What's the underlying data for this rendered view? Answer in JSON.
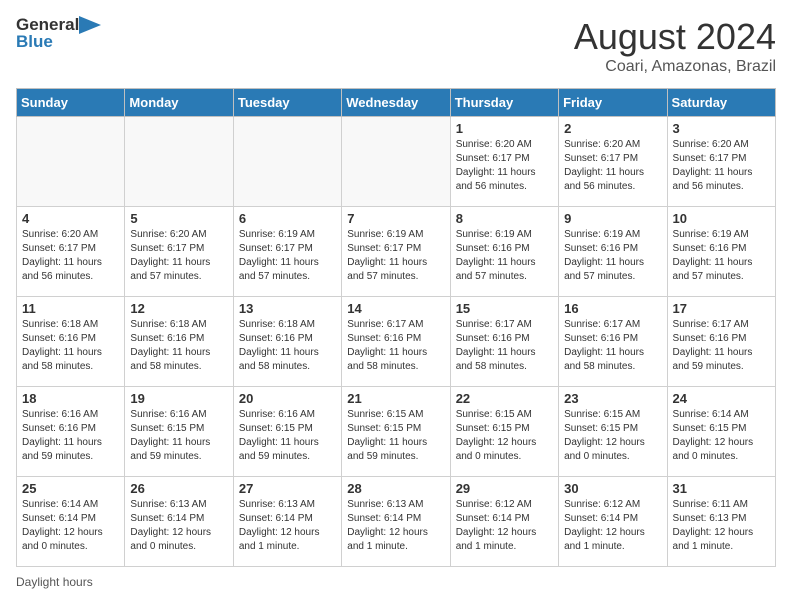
{
  "header": {
    "logo_general": "General",
    "logo_blue": "Blue",
    "title": "August 2024",
    "subtitle": "Coari, Amazonas, Brazil"
  },
  "calendar": {
    "days_of_week": [
      "Sunday",
      "Monday",
      "Tuesday",
      "Wednesday",
      "Thursday",
      "Friday",
      "Saturday"
    ],
    "weeks": [
      [
        {
          "day": "",
          "info": ""
        },
        {
          "day": "",
          "info": ""
        },
        {
          "day": "",
          "info": ""
        },
        {
          "day": "",
          "info": ""
        },
        {
          "day": "1",
          "info": "Sunrise: 6:20 AM\nSunset: 6:17 PM\nDaylight: 11 hours and 56 minutes."
        },
        {
          "day": "2",
          "info": "Sunrise: 6:20 AM\nSunset: 6:17 PM\nDaylight: 11 hours and 56 minutes."
        },
        {
          "day": "3",
          "info": "Sunrise: 6:20 AM\nSunset: 6:17 PM\nDaylight: 11 hours and 56 minutes."
        }
      ],
      [
        {
          "day": "4",
          "info": "Sunrise: 6:20 AM\nSunset: 6:17 PM\nDaylight: 11 hours and 56 minutes."
        },
        {
          "day": "5",
          "info": "Sunrise: 6:20 AM\nSunset: 6:17 PM\nDaylight: 11 hours and 57 minutes."
        },
        {
          "day": "6",
          "info": "Sunrise: 6:19 AM\nSunset: 6:17 PM\nDaylight: 11 hours and 57 minutes."
        },
        {
          "day": "7",
          "info": "Sunrise: 6:19 AM\nSunset: 6:17 PM\nDaylight: 11 hours and 57 minutes."
        },
        {
          "day": "8",
          "info": "Sunrise: 6:19 AM\nSunset: 6:16 PM\nDaylight: 11 hours and 57 minutes."
        },
        {
          "day": "9",
          "info": "Sunrise: 6:19 AM\nSunset: 6:16 PM\nDaylight: 11 hours and 57 minutes."
        },
        {
          "day": "10",
          "info": "Sunrise: 6:19 AM\nSunset: 6:16 PM\nDaylight: 11 hours and 57 minutes."
        }
      ],
      [
        {
          "day": "11",
          "info": "Sunrise: 6:18 AM\nSunset: 6:16 PM\nDaylight: 11 hours and 58 minutes."
        },
        {
          "day": "12",
          "info": "Sunrise: 6:18 AM\nSunset: 6:16 PM\nDaylight: 11 hours and 58 minutes."
        },
        {
          "day": "13",
          "info": "Sunrise: 6:18 AM\nSunset: 6:16 PM\nDaylight: 11 hours and 58 minutes."
        },
        {
          "day": "14",
          "info": "Sunrise: 6:17 AM\nSunset: 6:16 PM\nDaylight: 11 hours and 58 minutes."
        },
        {
          "day": "15",
          "info": "Sunrise: 6:17 AM\nSunset: 6:16 PM\nDaylight: 11 hours and 58 minutes."
        },
        {
          "day": "16",
          "info": "Sunrise: 6:17 AM\nSunset: 6:16 PM\nDaylight: 11 hours and 58 minutes."
        },
        {
          "day": "17",
          "info": "Sunrise: 6:17 AM\nSunset: 6:16 PM\nDaylight: 11 hours and 59 minutes."
        }
      ],
      [
        {
          "day": "18",
          "info": "Sunrise: 6:16 AM\nSunset: 6:16 PM\nDaylight: 11 hours and 59 minutes."
        },
        {
          "day": "19",
          "info": "Sunrise: 6:16 AM\nSunset: 6:15 PM\nDaylight: 11 hours and 59 minutes."
        },
        {
          "day": "20",
          "info": "Sunrise: 6:16 AM\nSunset: 6:15 PM\nDaylight: 11 hours and 59 minutes."
        },
        {
          "day": "21",
          "info": "Sunrise: 6:15 AM\nSunset: 6:15 PM\nDaylight: 11 hours and 59 minutes."
        },
        {
          "day": "22",
          "info": "Sunrise: 6:15 AM\nSunset: 6:15 PM\nDaylight: 12 hours and 0 minutes."
        },
        {
          "day": "23",
          "info": "Sunrise: 6:15 AM\nSunset: 6:15 PM\nDaylight: 12 hours and 0 minutes."
        },
        {
          "day": "24",
          "info": "Sunrise: 6:14 AM\nSunset: 6:15 PM\nDaylight: 12 hours and 0 minutes."
        }
      ],
      [
        {
          "day": "25",
          "info": "Sunrise: 6:14 AM\nSunset: 6:14 PM\nDaylight: 12 hours and 0 minutes."
        },
        {
          "day": "26",
          "info": "Sunrise: 6:13 AM\nSunset: 6:14 PM\nDaylight: 12 hours and 0 minutes."
        },
        {
          "day": "27",
          "info": "Sunrise: 6:13 AM\nSunset: 6:14 PM\nDaylight: 12 hours and 1 minute."
        },
        {
          "day": "28",
          "info": "Sunrise: 6:13 AM\nSunset: 6:14 PM\nDaylight: 12 hours and 1 minute."
        },
        {
          "day": "29",
          "info": "Sunrise: 6:12 AM\nSunset: 6:14 PM\nDaylight: 12 hours and 1 minute."
        },
        {
          "day": "30",
          "info": "Sunrise: 6:12 AM\nSunset: 6:14 PM\nDaylight: 12 hours and 1 minute."
        },
        {
          "day": "31",
          "info": "Sunrise: 6:11 AM\nSunset: 6:13 PM\nDaylight: 12 hours and 1 minute."
        }
      ]
    ]
  },
  "footer": {
    "note": "Daylight hours"
  }
}
